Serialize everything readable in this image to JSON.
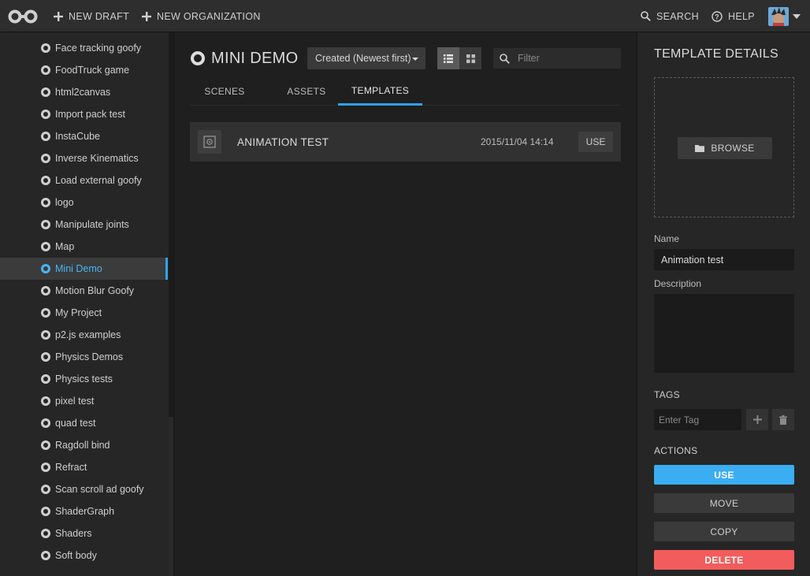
{
  "header": {
    "new_draft": "NEW DRAFT",
    "new_organization": "NEW ORGANIZATION",
    "search": "SEARCH",
    "help": "HELP"
  },
  "sidebar": {
    "items": [
      {
        "label": "Face tracking goofy"
      },
      {
        "label": "FoodTruck game"
      },
      {
        "label": "html2canvas"
      },
      {
        "label": "Import pack test"
      },
      {
        "label": "InstaCube"
      },
      {
        "label": "Inverse Kinematics"
      },
      {
        "label": "Load external goofy"
      },
      {
        "label": "logo"
      },
      {
        "label": "Manipulate joints"
      },
      {
        "label": "Map"
      },
      {
        "label": "Mini Demo",
        "active": true
      },
      {
        "label": "Motion Blur Goofy"
      },
      {
        "label": "My Project"
      },
      {
        "label": "p2.js examples"
      },
      {
        "label": "Physics Demos"
      },
      {
        "label": "Physics tests"
      },
      {
        "label": "pixel test"
      },
      {
        "label": "quad test"
      },
      {
        "label": "Ragdoll bind"
      },
      {
        "label": "Refract"
      },
      {
        "label": "Scan scroll ad goofy"
      },
      {
        "label": "ShaderGraph"
      },
      {
        "label": "Shaders"
      },
      {
        "label": "Soft body"
      }
    ]
  },
  "main": {
    "project_title": "MINI DEMO",
    "sort_value": "Created (Newest first)",
    "filter_placeholder": "Filter",
    "tabs": [
      {
        "label": "SCENES"
      },
      {
        "label": "ASSETS"
      },
      {
        "label": "TEMPLATES",
        "active": true
      }
    ],
    "templates": [
      {
        "name": "ANIMATION TEST",
        "date": "2015/11/04 14:14",
        "use_label": "USE"
      }
    ]
  },
  "details": {
    "title": "TEMPLATE DETAILS",
    "browse_label": "BROWSE",
    "name_label": "Name",
    "name_value": "Animation test",
    "description_label": "Description",
    "description_value": "",
    "tags_label": "TAGS",
    "tag_placeholder": "Enter Tag",
    "actions_label": "ACTIONS",
    "use_label": "USE",
    "move_label": "MOVE",
    "copy_label": "COPY",
    "delete_label": "DELETE"
  },
  "colors": {
    "accent": "#2fa4f0",
    "use_button": "#3badf2",
    "delete_button": "#f35c5c"
  }
}
